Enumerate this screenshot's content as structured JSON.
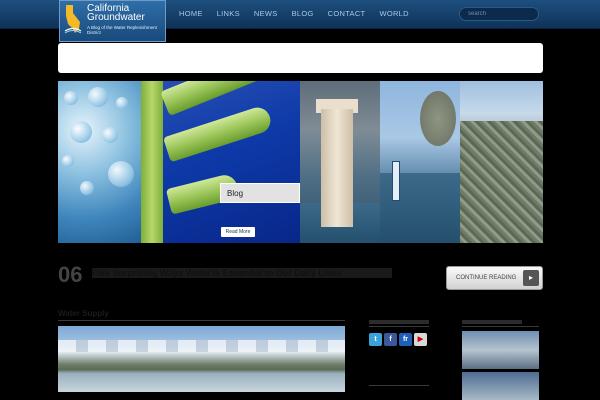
{
  "logo": {
    "line1": "California",
    "line2": "Groundwater",
    "tagline": "A Blog of the Water Replenishment District"
  },
  "nav": {
    "items": [
      "HOME",
      "LINKS",
      "NEWS",
      "BLOG",
      "CONTACT",
      "WORLD"
    ]
  },
  "search": {
    "placeholder": "search"
  },
  "feature": {
    "label": "Blog",
    "read_more": "Read More"
  },
  "post": {
    "number": "06",
    "title": "Five Surprising Ways Water Is Essential to Our Daily Lives",
    "continue_label": "CONTINUE READING",
    "continue_arrow": "▸"
  },
  "section": {
    "title": "Water Supply"
  },
  "social": {
    "icons": [
      "twitter-icon",
      "facebook-icon",
      "flickr-icon",
      "youtube-icon"
    ],
    "glyphs": [
      "t",
      "f",
      "fr",
      "▶"
    ],
    "colors": [
      "#3aa3d8",
      "#3b5998",
      "#1f5fb8",
      "#d9d9d9"
    ]
  },
  "colors": {
    "header": "#1e4f7e",
    "accent": "#2f6ea8"
  }
}
